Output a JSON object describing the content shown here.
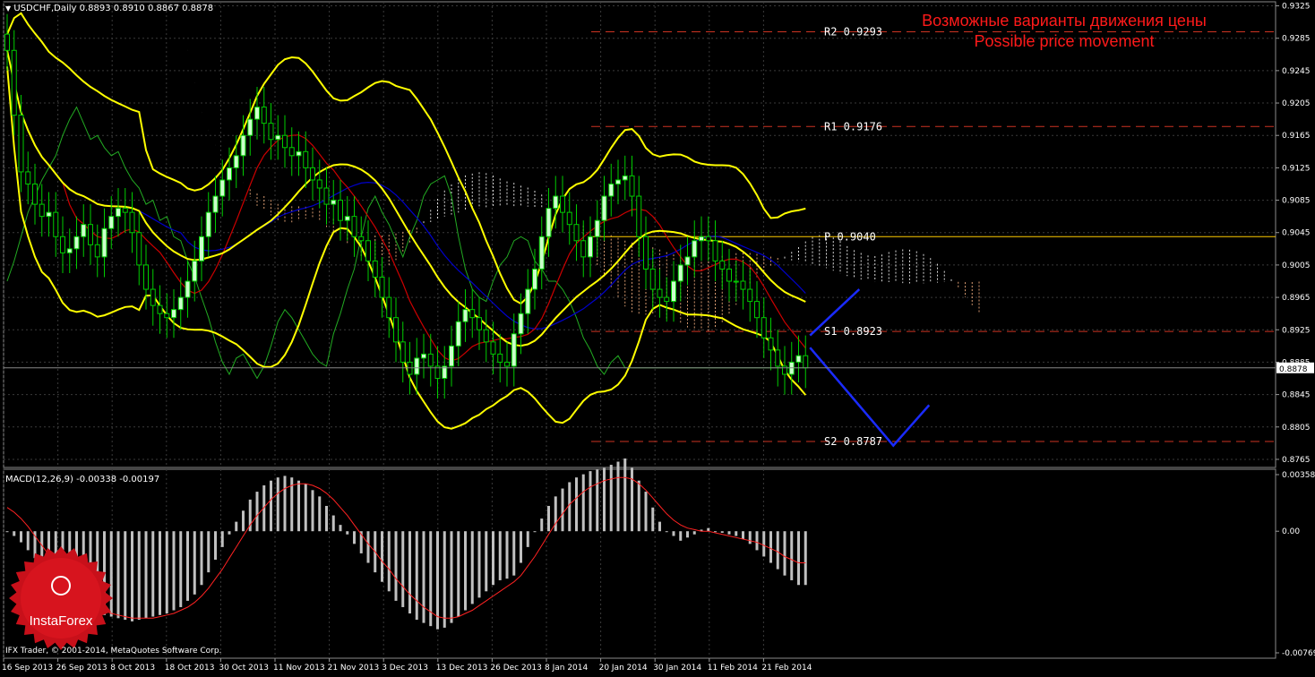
{
  "header": {
    "symbol_info": "USDCHF,Daily  0.8893 0.8910 0.8867 0.8878",
    "macd_info": "MACD(12,26,9) -0.00338 -0.00197",
    "copyright": "IFX Trader, © 2001-2014, MetaQuotes Software Corp."
  },
  "annotation": {
    "title_ru": "Возможные варианты движения цены",
    "title_en": "Possible price movement"
  },
  "logo": {
    "text": "InstaForex"
  },
  "colors": {
    "background": "#000000",
    "grid": "#3a3a3a",
    "bull_candle": "#ccffcc",
    "bear_candle": "#00cc00",
    "bollinger": "#ffff00",
    "tenkan": "#cc0000",
    "kijun": "#0000cc",
    "chikou": "#22aa22",
    "pivot_line": "#ffcc00",
    "level_lines": "#cc3322",
    "forecast": "#1a2bff",
    "macd_hist": "#c0c0c0",
    "macd_signal": "#ff2222",
    "title": "#ff1a1a"
  },
  "chart_data": [
    {
      "type": "candlestick",
      "symbol": "USDCHF",
      "timeframe": "Daily",
      "ylim": [
        0.8755,
        0.933
      ],
      "y_ticks": [
        "0.9325",
        "0.9285",
        "0.9245",
        "0.9205",
        "0.9165",
        "0.9125",
        "0.9085",
        "0.9045",
        "0.9005",
        "0.8965",
        "0.8925",
        "0.8885",
        "0.8845",
        "0.8805",
        "0.8765"
      ],
      "current_price": "0.8878",
      "x_ticks": [
        "16 Sep 2013",
        "26 Sep 2013",
        "8 Oct 2013",
        "18 Oct 2013",
        "30 Oct 2013",
        "11 Nov 2013",
        "21 Nov 2013",
        "3 Dec 2013",
        "13 Dec 2013",
        "26 Dec 2013",
        "8 Jan 2014",
        "20 Jan 2014",
        "30 Jan 2014",
        "11 Feb 2014",
        "21 Feb 2014"
      ],
      "levels": [
        {
          "name": "R2",
          "value": 0.9293,
          "label": "R2  0.9293"
        },
        {
          "name": "R1",
          "value": 0.9176,
          "label": "R1  0.9176"
        },
        {
          "name": "P",
          "value": 0.904,
          "label": "P  0.9040"
        },
        {
          "name": "S1",
          "value": 0.8923,
          "label": "S1  0.8923"
        },
        {
          "name": "S2",
          "value": 0.8787,
          "label": "S2  0.8787"
        }
      ],
      "close": [
        0.927,
        0.919,
        0.912,
        0.9105,
        0.908,
        0.9065,
        0.907,
        0.904,
        0.902,
        0.9025,
        0.904,
        0.9055,
        0.903,
        0.9015,
        0.905,
        0.9065,
        0.9075,
        0.907,
        0.9045,
        0.9005,
        0.8975,
        0.8955,
        0.8945,
        0.894,
        0.895,
        0.8965,
        0.8985,
        0.901,
        0.904,
        0.907,
        0.909,
        0.911,
        0.9125,
        0.914,
        0.9165,
        0.9185,
        0.92,
        0.918,
        0.916,
        0.9165,
        0.915,
        0.914,
        0.9145,
        0.9125,
        0.911,
        0.91,
        0.908,
        0.9085,
        0.906,
        0.9065,
        0.904,
        0.9035,
        0.901,
        0.899,
        0.8965,
        0.894,
        0.891,
        0.8885,
        0.887,
        0.889,
        0.8895,
        0.888,
        0.8865,
        0.888,
        0.8905,
        0.8935,
        0.895,
        0.894,
        0.8925,
        0.891,
        0.8895,
        0.8885,
        0.888,
        0.892,
        0.8945,
        0.8975,
        0.9,
        0.904,
        0.9075,
        0.909,
        0.907,
        0.9055,
        0.9035,
        0.9015,
        0.904,
        0.906,
        0.909,
        0.9105,
        0.911,
        0.9115,
        0.909,
        0.904,
        0.9,
        0.8975,
        0.8965,
        0.896,
        0.8985,
        0.9005,
        0.9015,
        0.9035,
        0.904,
        0.9035,
        0.901,
        0.9,
        0.8985,
        0.8985,
        0.8975,
        0.896,
        0.894,
        0.8915,
        0.89,
        0.888,
        0.887,
        0.8885,
        0.8893,
        0.8878
      ]
    },
    {
      "type": "bar",
      "name": "MACD(12,26,9)",
      "ylim": [
        -0.00769,
        0.00358
      ],
      "y_ticks": [
        "0.00358",
        "0.00",
        "-0.00769"
      ],
      "histogram": [
        0.0,
        -0.0003,
        -0.0007,
        -0.0012,
        -0.0017,
        -0.0022,
        -0.0027,
        -0.003,
        -0.0034,
        -0.0038,
        -0.0042,
        -0.0046,
        -0.005,
        -0.0052,
        -0.0053,
        -0.0054,
        -0.0055,
        -0.0056,
        -0.0057,
        -0.0056,
        -0.0055,
        -0.0054,
        -0.0053,
        -0.0052,
        -0.005,
        -0.0048,
        -0.0044,
        -0.004,
        -0.0034,
        -0.0026,
        -0.0018,
        -0.001,
        -0.0002,
        0.0006,
        0.0013,
        0.002,
        0.0025,
        0.0029,
        0.0032,
        0.0034,
        0.0035,
        0.0034,
        0.0032,
        0.003,
        0.0026,
        0.0022,
        0.0016,
        0.001,
        0.0004,
        -0.0002,
        -0.0008,
        -0.0014,
        -0.002,
        -0.0026,
        -0.0032,
        -0.0038,
        -0.0044,
        -0.0048,
        -0.0052,
        -0.0056,
        -0.0058,
        -0.006,
        -0.0062,
        -0.0061,
        -0.0058,
        -0.0054,
        -0.005,
        -0.0046,
        -0.0042,
        -0.0038,
        -0.0034,
        -0.0031,
        -0.003,
        -0.0028,
        -0.002,
        -0.001,
        0.0,
        0.0008,
        0.0016,
        0.0022,
        0.0027,
        0.0031,
        0.0034,
        0.0036,
        0.0038,
        0.0039,
        0.004,
        0.0042,
        0.0044,
        0.0046,
        0.004,
        0.0032,
        0.0025,
        0.0015,
        0.0006,
        0.0,
        -0.0003,
        -0.0006,
        -0.0004,
        -0.0002,
        0.0001,
        0.0002,
        0.0,
        -0.0001,
        -0.0002,
        -0.0003,
        -0.0005,
        -0.0008,
        -0.0012,
        -0.0016,
        -0.002,
        -0.0024,
        -0.0028,
        -0.0031,
        -0.0034,
        -0.0034
      ],
      "signal": [
        0.0015,
        0.0012,
        0.0008,
        0.0003,
        -0.0003,
        -0.0009,
        -0.0015,
        -0.0021,
        -0.0027,
        -0.0032,
        -0.0037,
        -0.0041,
        -0.0045,
        -0.0048,
        -0.005,
        -0.0052,
        -0.0053,
        -0.0054,
        -0.0055,
        -0.0055,
        -0.0055,
        -0.0055,
        -0.0054,
        -0.0053,
        -0.0052,
        -0.005,
        -0.0048,
        -0.0045,
        -0.0041,
        -0.0036,
        -0.003,
        -0.0024,
        -0.0017,
        -0.001,
        -0.0003,
        0.0004,
        0.001,
        0.0015,
        0.002,
        0.0024,
        0.0027,
        0.0029,
        0.003,
        0.003,
        0.0029,
        0.0027,
        0.0024,
        0.002,
        0.0015,
        0.001,
        0.0004,
        -0.0002,
        -0.0008,
        -0.0013,
        -0.0019,
        -0.0024,
        -0.003,
        -0.0035,
        -0.004,
        -0.0044,
        -0.0048,
        -0.0051,
        -0.0054,
        -0.0055,
        -0.0055,
        -0.0054,
        -0.0052,
        -0.005,
        -0.0047,
        -0.0044,
        -0.0041,
        -0.0038,
        -0.0035,
        -0.0032,
        -0.0028,
        -0.0022,
        -0.0016,
        -0.0009,
        -0.0002,
        0.0005,
        0.0011,
        0.0017,
        0.0021,
        0.0025,
        0.0028,
        0.003,
        0.0032,
        0.0033,
        0.0034,
        0.0034,
        0.0033,
        0.003,
        0.0026,
        0.0021,
        0.0016,
        0.0011,
        0.0007,
        0.0004,
        0.0002,
        0.0001,
        0.0,
        0.0,
        -0.0001,
        -0.0002,
        -0.0003,
        -0.0004,
        -0.0005,
        -0.0006,
        -0.0007,
        -0.0009,
        -0.0011,
        -0.0013,
        -0.0016,
        -0.0018,
        -0.002,
        -0.002
      ]
    }
  ]
}
